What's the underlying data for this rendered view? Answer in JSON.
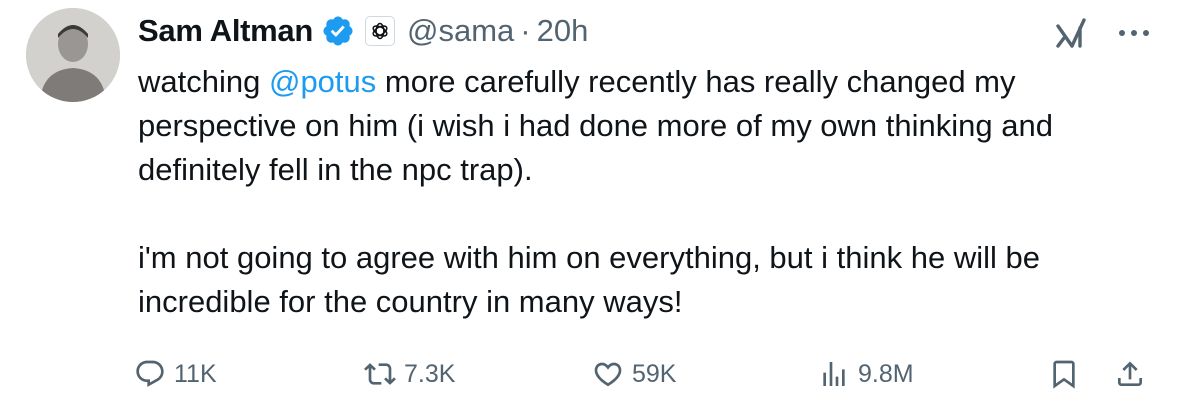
{
  "author": {
    "name": "Sam Altman",
    "handle": "@sama",
    "separator": "·",
    "time": "20h",
    "verified_color": "#1d9bf0",
    "affiliation_icon": "openai-logo-icon",
    "avatar_icon": "profile-photo"
  },
  "tweet": {
    "line1_pre": "watching ",
    "mention": "@potus",
    "line1_post": " more carefully recently has really changed my perspective on him (i wish i had done more of my own thinking and definitely fell in the npc trap).",
    "paragraph2": "i'm not going to agree with him on everything, but i think he will be incredible for the country in many ways!",
    "mention_color": "#1d9bf0"
  },
  "top_right": {
    "grok_icon": "grok-icon",
    "more_icon": "more-icon"
  },
  "actions": {
    "replies": "11K",
    "reposts": "7.3K",
    "likes": "59K",
    "views": "9.8M",
    "bookmark_icon": "bookmark-icon",
    "share_icon": "share-icon"
  },
  "colors": {
    "text": "#0f1419",
    "secondary": "#536471",
    "accent": "#1d9bf0"
  }
}
